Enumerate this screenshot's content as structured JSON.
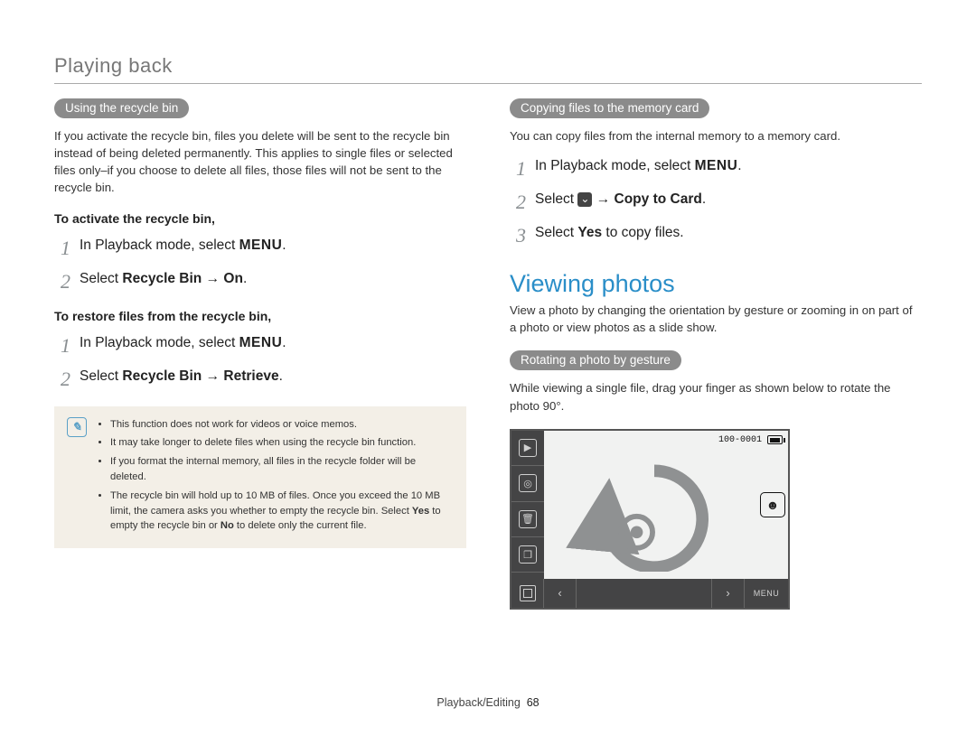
{
  "header": {
    "section": "Playing back"
  },
  "left": {
    "pill1": "Using the recycle bin",
    "intro": "If you activate the recycle bin, files you delete will be sent to the recycle bin instead of being deleted permanently. This applies to single files or selected files only–if you choose to delete all files, those files will not be sent to the recycle bin.",
    "sub1": "To activate the recycle bin,",
    "s1n1": "1",
    "s1t1_a": "In Playback mode, select ",
    "s1t1_b": ".",
    "s1n2": "2",
    "s1t2_a": "Select ",
    "s1t2_b": "Recycle Bin",
    "s1t2_c": " → ",
    "s1t2_d": "On",
    "s1t2_e": ".",
    "sub2": "To restore files from the recycle bin,",
    "s2n1": "1",
    "s2t1_a": "In Playback mode, select ",
    "s2t1_b": ".",
    "s2n2": "2",
    "s2t2_a": "Select ",
    "s2t2_b": "Recycle Bin",
    "s2t2_c": " → ",
    "s2t2_d": "Retrieve",
    "s2t2_e": ".",
    "notes": {
      "n1": "This function does not work for videos or voice memos.",
      "n2": "It may take longer to delete files when using the recycle bin function.",
      "n3": "If you format the internal memory, all files in the recycle folder will be deleted.",
      "n4_a": "The recycle bin will hold up to 10 MB of files. Once you exceed the 10 MB limit, the camera asks you whether to empty the recycle bin. Select ",
      "n4_b": "Yes",
      "n4_c": " to empty the recycle bin or ",
      "n4_d": "No",
      "n4_e": " to delete only the current file."
    }
  },
  "right": {
    "pill1": "Copying files to the memory card",
    "intro": "You can copy files from the internal memory to a memory card.",
    "s1n1": "1",
    "s1t1_a": "In Playback mode, select ",
    "s1t1_b": ".",
    "s1n2": "2",
    "s1t2_a": "Select ",
    "s1t2_b": " → ",
    "s1t2_c": "Copy to Card",
    "s1t2_d": ".",
    "s1n3": "3",
    "s1t3_a": "Select ",
    "s1t3_b": "Yes",
    "s1t3_c": " to copy files.",
    "h2": "Viewing photos",
    "vp_intro": "View a photo by changing the orientation by gesture or zooming in on part of a photo or view photos as a slide show.",
    "pill2": "Rotating a photo by gesture",
    "rot_text": "While viewing a single file, drag your finger as shown below to rotate the photo 90°.",
    "ss": {
      "counter": "100-0001",
      "menu": "MENU"
    }
  },
  "menu_word": "MENU",
  "footer": {
    "path": "Playback/Editing",
    "page": "68"
  }
}
